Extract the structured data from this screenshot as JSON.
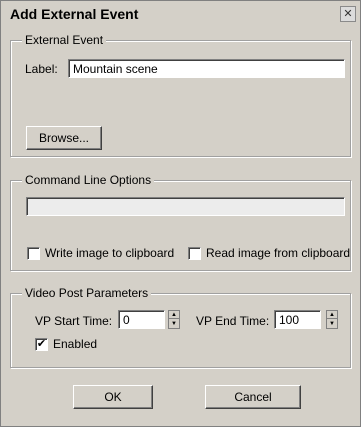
{
  "dialog": {
    "title": "Add External Event",
    "close_glyph": "✕"
  },
  "external_event": {
    "group_label": "External Event",
    "label_caption": "Label:",
    "label_value": "Mountain scene",
    "browse_label": "Browse..."
  },
  "command_line": {
    "group_label": "Command Line Options",
    "value": "",
    "write_clipboard_label": "Write image to clipboard",
    "write_clipboard_checked": false,
    "read_clipboard_label": "Read image from clipboard",
    "read_clipboard_checked": false
  },
  "video_post": {
    "group_label": "Video Post Parameters",
    "start_caption": "VP Start Time:",
    "start_value": "0",
    "end_caption": "VP End Time:",
    "end_value": "100",
    "enabled_label": "Enabled",
    "enabled_checked": true,
    "check_glyph": "✔"
  },
  "buttons": {
    "ok_label": "OK",
    "cancel_label": "Cancel"
  }
}
